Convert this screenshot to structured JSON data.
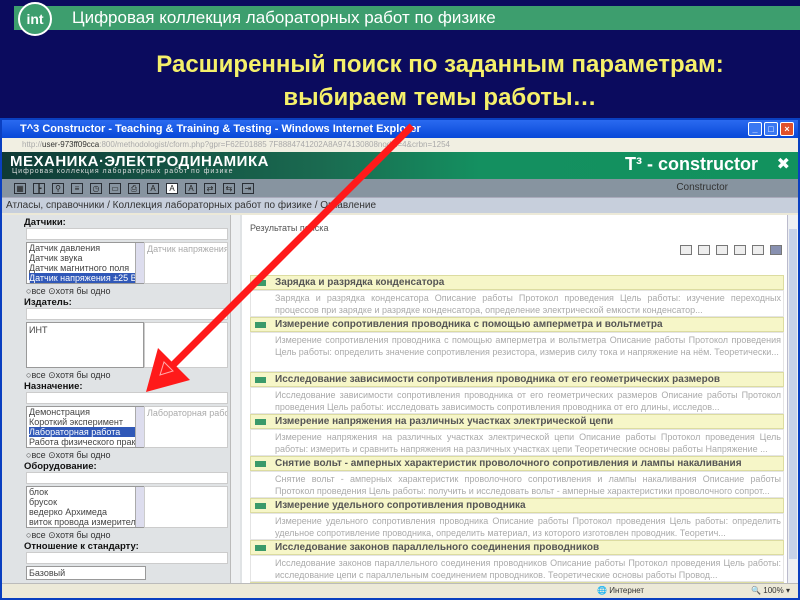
{
  "slide": {
    "logo": "int",
    "header": "Цифровая коллекция лабораторных работ по физике",
    "title_line1": "Расширенный поиск по заданным параметрам:",
    "title_line2": "выбираем темы работы…"
  },
  "browser": {
    "title": "T^3 Constructor - Teaching & Training & Testing - Windows Internet Explorer",
    "address_prefix": "http://",
    "address_host": "user-973ff09cca",
    "address_rest": ":800/methodologist/cform.php?gpr=F62E01885 7F8884741202A8A974130808nodul=4&crbn=1254",
    "banner_title": "МЕХАНИКА·ЭЛЕКТРОДИНАМИКА",
    "banner_subtitle": "Цифровая коллекция лабораторных работ по физике",
    "banner_brand": "T³ - constructor",
    "toolbar_label": "Constructor",
    "breadcrumb": "Атласы, справочники / Коллекция лабораторных работ по физике  / Оглавление",
    "status_zone": "Интернет",
    "zoom": "100%"
  },
  "filters": {
    "all": "все",
    "any": "хотя бы одно",
    "sensors": {
      "label": "Датчики:",
      "items": [
        "Датчик давления",
        "Датчик звука",
        "Датчик магнитного поля",
        "Датчик напряжения ±25 В"
      ],
      "selected": "Датчик напряжения ±25 В"
    },
    "publisher": {
      "label": "Издатель:",
      "items": [
        "ИНТ"
      ]
    },
    "purpose": {
      "label": "Назначение:",
      "items": [
        "Демонстрация",
        "Короткий эксперимент",
        "Лабораторная работа",
        "Работа физического практикума"
      ],
      "selected": "Лабораторная работа"
    },
    "equipment": {
      "label": "Оборудование:",
      "items": [
        "блок",
        "брусок",
        "ведерко Архимеда",
        "виток провода измерительный"
      ]
    },
    "standard": {
      "label": "Отношение к стандарту:",
      "items": [
        "Базовый"
      ]
    }
  },
  "results": {
    "header": "Результаты поиска",
    "items": [
      {
        "title": "Зарядка и разрядка конденсатора",
        "desc": "Зарядка и разрядка конденсатора Описание работы Протокол проведения Цель работы: изучение переходных процессов при зарядке и разрядке конденсатора, определение электрической емкости конденсатор..."
      },
      {
        "title": "Измерение сопротивления проводника с помощью амперметра и вольтметра",
        "desc": "Измерение сопротивления проводника с помощью амперметра и вольтметра Описание работы Протокол проведения Цель работы: определить значение сопротивления резистора, измерив силу тока и напряжение на нём. Теоретически..."
      },
      {
        "title": "Исследование зависимости сопротивления проводника от его геометрических размеров",
        "desc": "Исследование зависимости сопротивления проводника от его геометрических размеров Описание работы Протокол проведения Цель работы: исследовать зависимость сопротивления проводника от его длины, исследов..."
      },
      {
        "title": "Измерение напряжения на различных участках электрической цепи",
        "desc": "Измерение напряжения на различных участках электрической цепи Описание работы Протокол проведения Цель работы: измерить и сравнить напряжения на различных участках цепи Теоретические основы работы Напряжение ..."
      },
      {
        "title": "Снятие вольт - амперных характеристик проволочного сопротивления и лампы накаливания",
        "desc": "Снятие вольт - амперных характеристик проволочного сопротивления и лампы накаливания Описание работы Протокол проведения Цель работы: получить и исследовать вольт - амперные характеристики проволочного сопрот..."
      },
      {
        "title": "Измерение удельного сопротивления проводника",
        "desc": "Измерение удельного сопротивления проводника Описание работы Протокол проведения Цель работы: определить удельное сопротивление проводника, определить материал, из которого изготовлен проводник. Теоретич..."
      },
      {
        "title": "Исследование законов параллельного соединения проводников",
        "desc": "Исследование законов параллельного соединения проводников Описание работы Протокол проведения Цель работы: исследование цепи с параллельным соединением проводников. Теоретические основы работы Провод..."
      },
      {
        "title": "Исследование законов последовательного соединения проводников",
        "desc": ""
      }
    ]
  },
  "colors": {
    "slide_bg": "#0b0b5e",
    "accent_green": "#3d9e6e",
    "title_yellow": "#f5f06a",
    "arrow": "#ff1a1a",
    "result_title_bg": "#f6f6c8"
  }
}
